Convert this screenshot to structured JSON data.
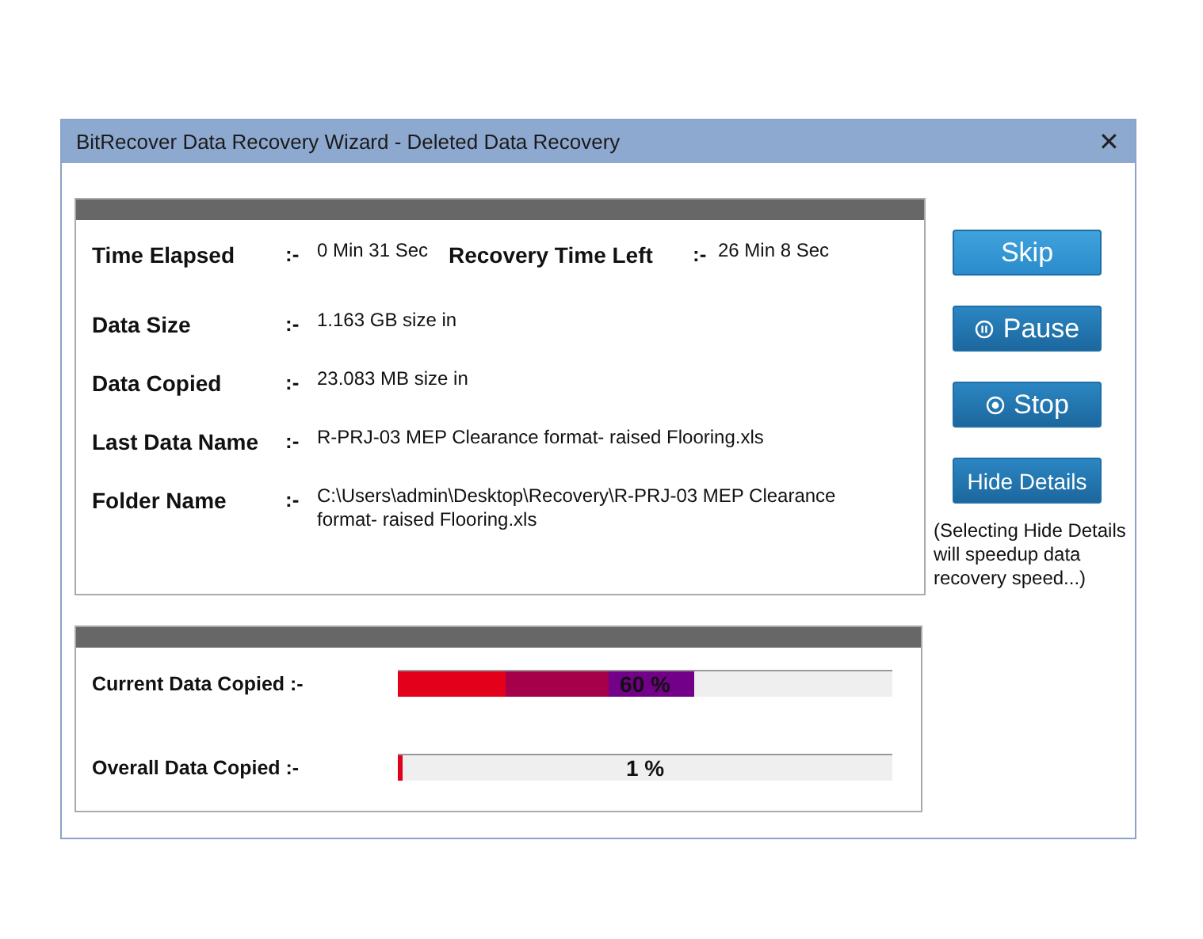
{
  "window": {
    "title": "BitRecover Data Recovery Wizard - Deleted Data Recovery",
    "close": "✕"
  },
  "details": [
    {
      "label": "Time Elapsed",
      "separator": ":-",
      "value": "0 Min 31 Sec",
      "extra_label": "Recovery Time Left",
      "extra_separator": ":-",
      "extra_value": "26 Min 8 Sec"
    },
    {
      "label": "Data Size",
      "separator": ":-",
      "value": "1.163 GB size in"
    },
    {
      "label": "Data Copied",
      "separator": ":-",
      "value": "23.083 MB size in"
    },
    {
      "label": "Last Data Name",
      "separator": ":-",
      "value": "R-PRJ-03 MEP Clearance format- raised Flooring.xls"
    },
    {
      "label": "Folder Name",
      "separator": ":-",
      "value": "C:\\Users\\admin\\Desktop\\Recovery\\R-PRJ-03 MEP Clearance format- raised Flooring.xls"
    }
  ],
  "progress": [
    {
      "label": "Current Data Copied :-",
      "level": 0.6,
      "percent": "60 %"
    },
    {
      "label": "Overall Data Copied :-",
      "level": 0.01,
      "percent": "1 %"
    }
  ],
  "buttons": [
    {
      "label": "Skip",
      "kind": "plain"
    },
    {
      "label": "Pause",
      "kind": "pause"
    },
    {
      "label": "Stop",
      "kind": "stop"
    },
    {
      "label": "Hide Details",
      "kind": "plain"
    }
  ],
  "note": "(Selecting Hide Details will speedup data recovery speed...)"
}
